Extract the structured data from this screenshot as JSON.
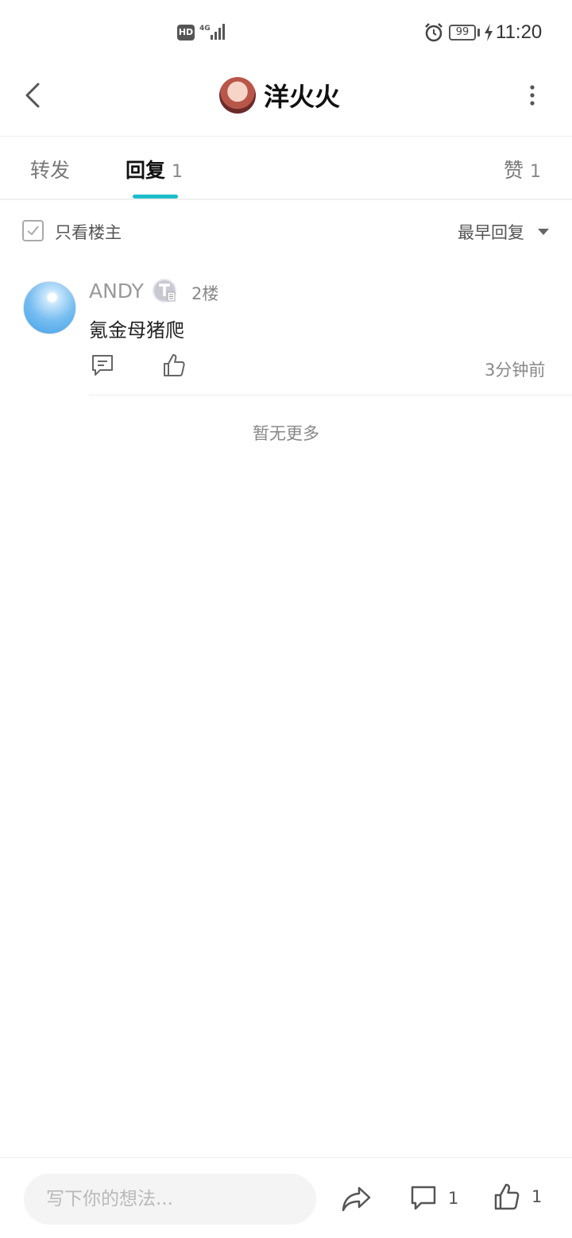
{
  "status_bar": {
    "hd_label": "HD",
    "network_label": "4G",
    "battery_level": "99",
    "time": "11:20"
  },
  "header": {
    "title": "洋火火"
  },
  "tabs": [
    {
      "label": "转发",
      "count": ""
    },
    {
      "label": "回复",
      "count": "1"
    },
    {
      "label": "赞",
      "count": "1"
    }
  ],
  "filter": {
    "only_op_label": "只看楼主",
    "sort_label": "最早回复"
  },
  "comment": {
    "user": "ANDY",
    "floor": "2楼",
    "text": "氪金母猪爬",
    "time": "3分钟前"
  },
  "no_more_text": "暂无更多",
  "bottom_bar": {
    "input_placeholder": "写下你的想法...",
    "comment_count": "1",
    "like_count": "1"
  },
  "colors": {
    "accent": "#1ebecb",
    "text_primary": "#222222",
    "text_secondary": "#888888"
  }
}
